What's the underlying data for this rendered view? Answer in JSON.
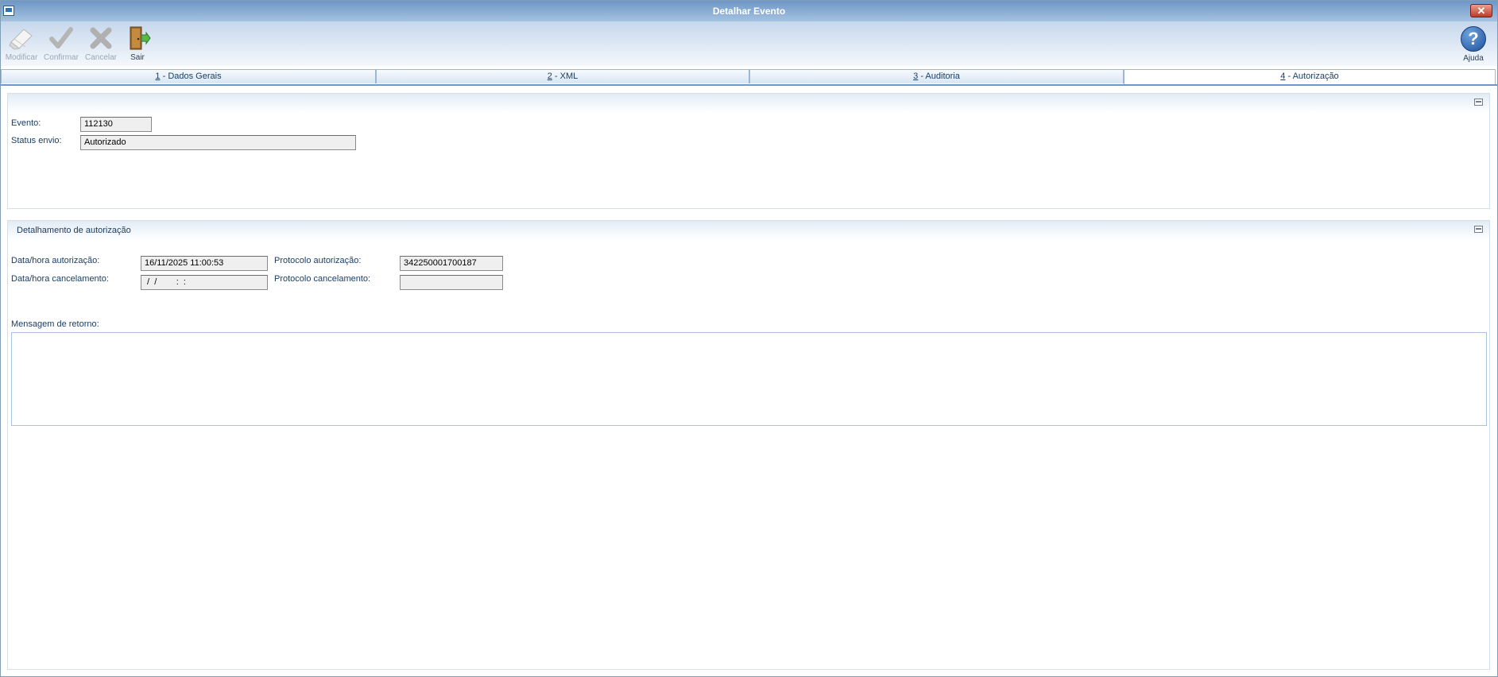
{
  "window": {
    "title": "Detalhar Evento",
    "close_label": "✕"
  },
  "toolbar": {
    "modificar": "Modificar",
    "confirmar": "Confirmar",
    "cancelar": "Cancelar",
    "sair": "Sair",
    "ajuda": "Ajuda"
  },
  "tabs": [
    {
      "key": "1",
      "label": " - Dados Gerais"
    },
    {
      "key": "2",
      "label": " - XML"
    },
    {
      "key": "3",
      "label": " - Auditoria"
    },
    {
      "key": "4",
      "label": " - Autorização"
    }
  ],
  "general": {
    "evento_label": "Evento:",
    "evento_value": "112130",
    "status_label": "Status envio:",
    "status_value": "Autorizado"
  },
  "detail": {
    "title": "Detalhamento de autorização",
    "data_aut_label": "Data/hora autorização:",
    "data_aut_value": "16/11/2025 11:00:53",
    "protocolo_aut_label": "Protocolo autorização:",
    "protocolo_aut_value": "342250001700187",
    "data_canc_label": "Data/hora cancelamento:",
    "data_canc_value": " /  /        :  :",
    "protocolo_canc_label": "Protocolo cancelamento:",
    "protocolo_canc_value": "",
    "mensagem_label": "Mensagem de retorno:",
    "mensagem_value": ""
  },
  "colors": {
    "accent": "#1a3e66",
    "title_bar": "#6d97c7"
  },
  "icons": {
    "modificar": "pencil-eraser-icon",
    "confirmar": "check-icon",
    "cancelar": "x-icon",
    "sair": "door-exit-icon",
    "ajuda": "help-icon"
  }
}
